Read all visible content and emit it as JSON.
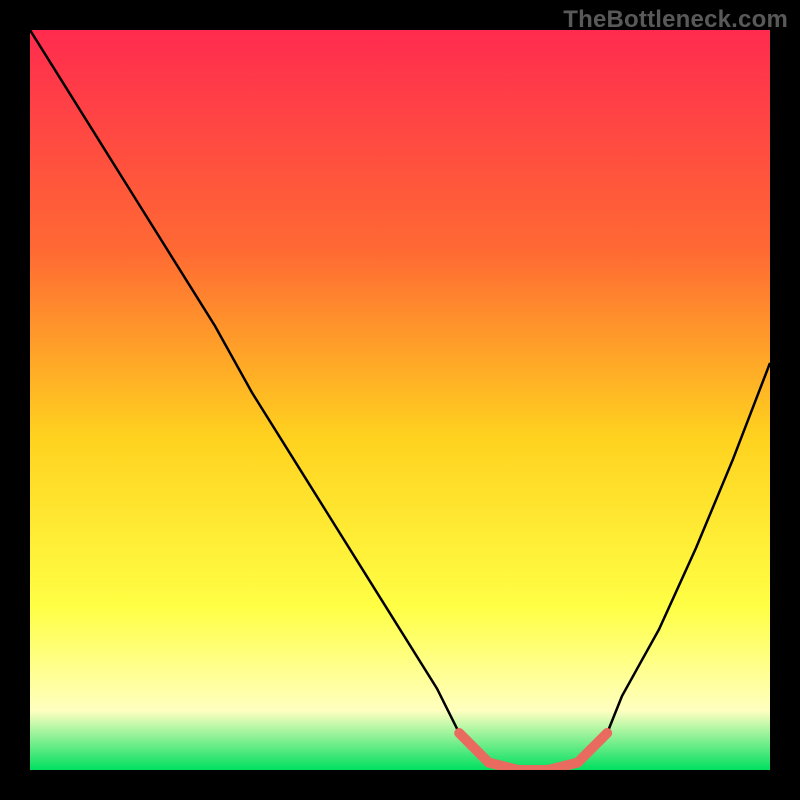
{
  "watermark": "TheBottleneck.com",
  "colors": {
    "gradient_top": "#ff2b4f",
    "gradient_mid1": "#ff6a33",
    "gradient_mid2": "#ffd21f",
    "gradient_mid3": "#ffff45",
    "gradient_mid4": "#ffffc0",
    "gradient_bottom": "#00e060",
    "curve": "#000000",
    "highlight": "#e96a5f",
    "frame": "#000000"
  },
  "chart_data": {
    "type": "line",
    "title": "",
    "xlabel": "",
    "ylabel": "",
    "xlim": [
      0,
      100
    ],
    "ylim": [
      0,
      100
    ],
    "grid": false,
    "legend": false,
    "series": [
      {
        "name": "bottleneck-curve",
        "x": [
          0,
          5,
          10,
          15,
          20,
          25,
          30,
          35,
          40,
          45,
          50,
          55,
          58,
          62,
          66,
          70,
          74,
          78,
          80,
          85,
          90,
          95,
          100
        ],
        "values": [
          100,
          92,
          84,
          76,
          68,
          60,
          51,
          43,
          35,
          27,
          19,
          11,
          5,
          1,
          0,
          0,
          1,
          5,
          10,
          19,
          30,
          42,
          55
        ]
      }
    ],
    "highlight_segment": {
      "name": "optimal-range",
      "x": [
        58,
        62,
        66,
        70,
        74,
        78
      ],
      "values": [
        5,
        1,
        0,
        0,
        1,
        5
      ]
    }
  }
}
